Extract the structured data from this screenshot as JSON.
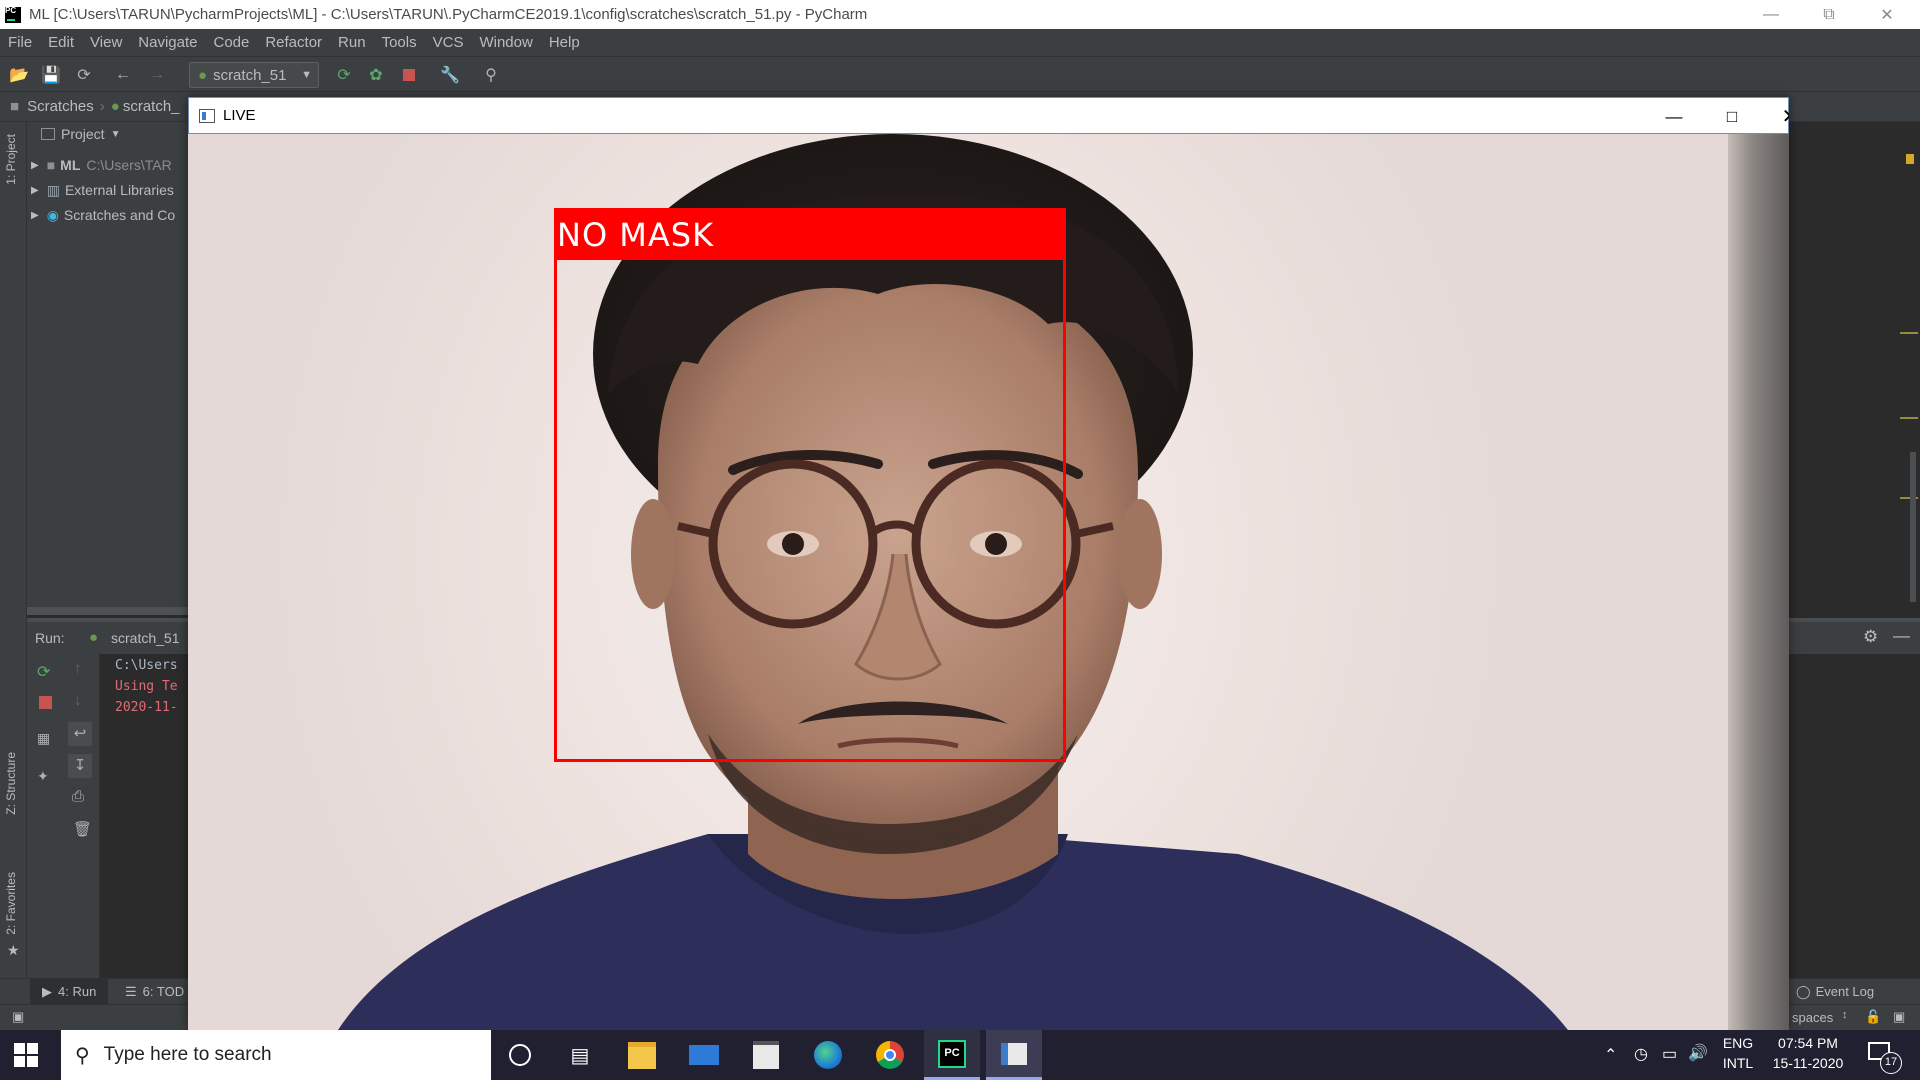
{
  "window": {
    "title": "ML [C:\\Users\\TARUN\\PycharmProjects\\ML] - C:\\Users\\TARUN\\.PyCharmCE2019.1\\config\\scratches\\scratch_51.py - PyCharm"
  },
  "menu": {
    "items": [
      "File",
      "Edit",
      "View",
      "Navigate",
      "Code",
      "Refactor",
      "Run",
      "Tools",
      "VCS",
      "Window",
      "Help"
    ]
  },
  "toolbar": {
    "run_config": "scratch_51"
  },
  "breadcrumb": {
    "items": [
      "Scratches",
      "scratch_"
    ]
  },
  "left_stripe": {
    "project_tab": "1: Project",
    "structure_tab": "Z: Structure",
    "favorites_tab": "2: Favorites"
  },
  "project_panel": {
    "header": "Project",
    "tree": [
      {
        "label": "ML",
        "sub": "C:\\Users\\TAR"
      },
      {
        "label": "External Libraries"
      },
      {
        "label": "Scratches and Co"
      }
    ]
  },
  "run_panel": {
    "label": "Run:",
    "tab": "scratch_51",
    "console": [
      {
        "text": "C:\\Users",
        "color": "#a9b7c6"
      },
      {
        "text": "Using Te",
        "color": "#e06c75"
      },
      {
        "text": "2020-11-",
        "color": "#e06c75"
      }
    ]
  },
  "bottom_tabs": {
    "run": "4: Run",
    "todo": "6: TOD",
    "event_log": "Event Log"
  },
  "status": {
    "indent": "spaces"
  },
  "live_window": {
    "title": "LIVE",
    "detection_label": "NO MASK",
    "box_color": "#ff0000"
  },
  "taskbar": {
    "search_placeholder": "Type here to search",
    "lang_top": "ENG",
    "lang_bottom": "INTL",
    "time": "07:54 PM",
    "date": "15-11-2020",
    "notifications": "17"
  }
}
